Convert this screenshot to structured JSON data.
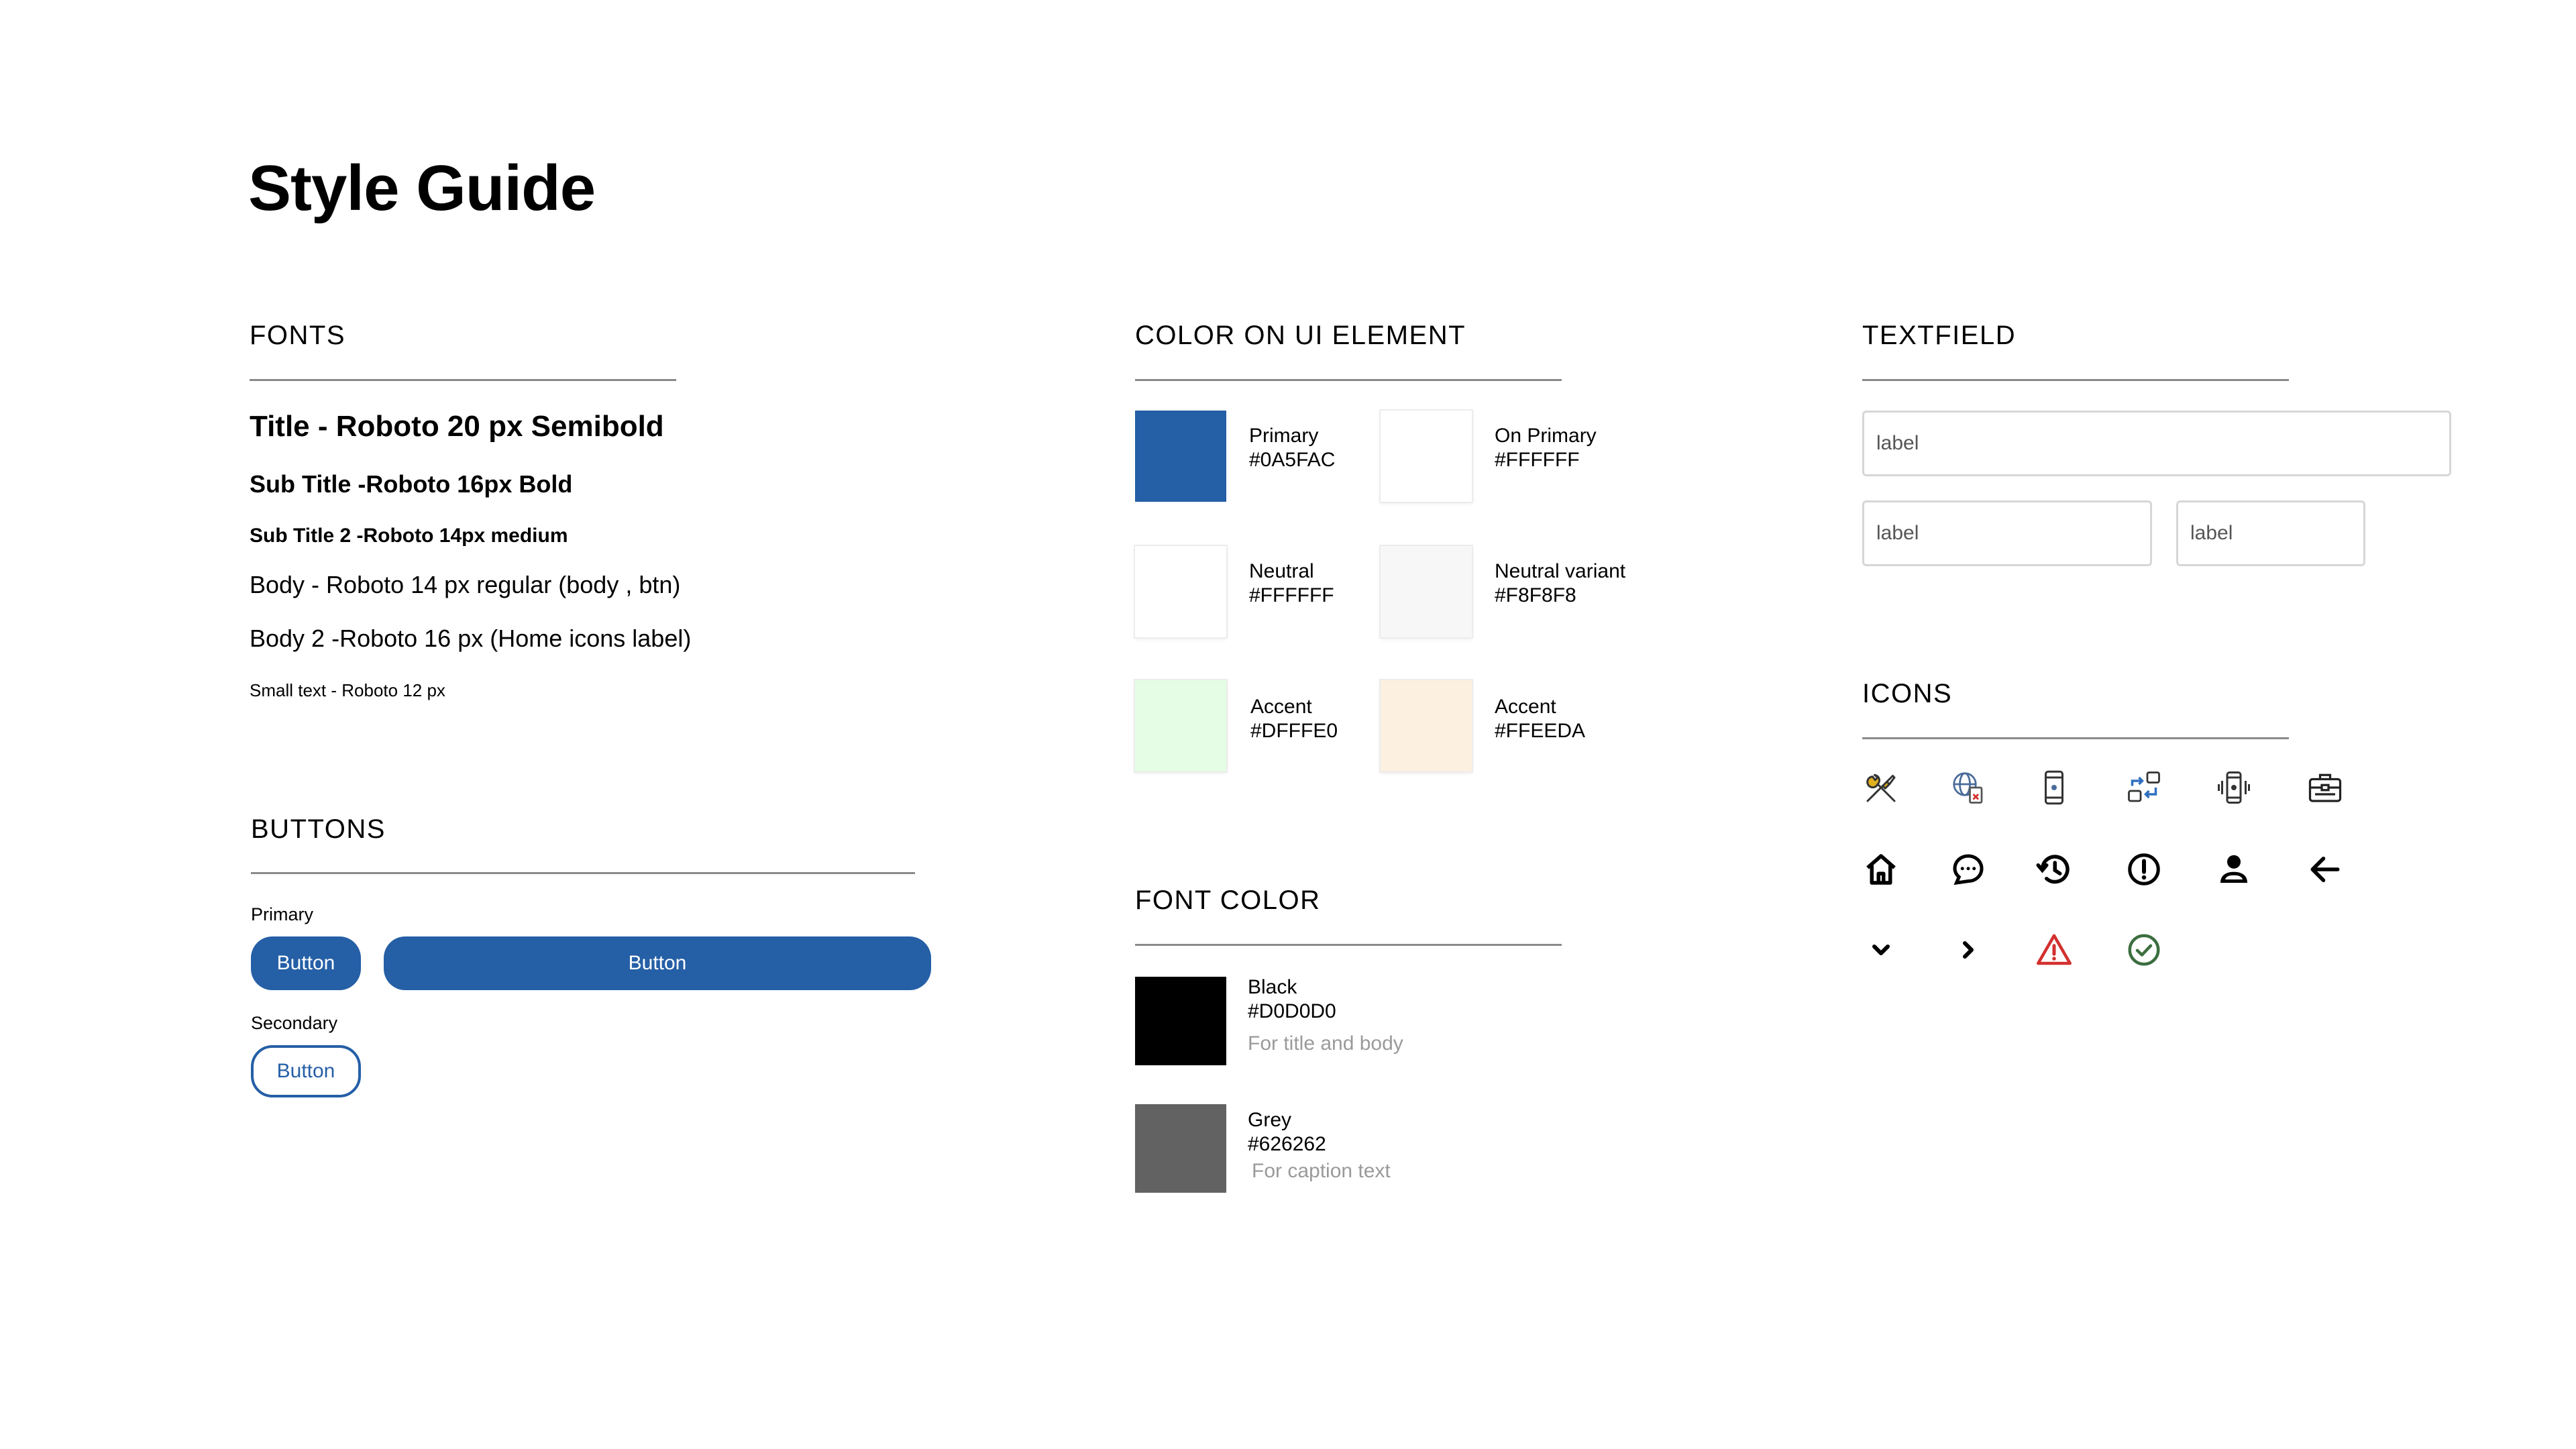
{
  "page": {
    "title": "Style Guide"
  },
  "fonts": {
    "heading": "FONTS",
    "samples": [
      "Title - Roboto 20 px Semibold",
      "Sub Title -Roboto 16px Bold",
      "Sub Title 2 -Roboto 14px medium",
      "Body - Roboto 14 px regular (body , btn)",
      "Body 2 -Roboto 16 px (Home icons label)",
      "Small text - Roboto 12 px"
    ]
  },
  "buttons": {
    "heading": "BUTTONS",
    "primary_label": "Primary",
    "secondary_label": "Secondary",
    "button_text": "Button"
  },
  "colors": {
    "heading": "COLOR ON UI ELEMENT",
    "swatches": [
      {
        "name": "Primary",
        "hex": "#0A5FAC",
        "fill": "#255fa6"
      },
      {
        "name": "On Primary",
        "hex": "#FFFFFF",
        "fill": "#ffffff"
      },
      {
        "name": "Neutral",
        "hex": "#FFFFFF",
        "fill": "#ffffff"
      },
      {
        "name": "Neutral variant",
        "hex": "#F8F8F8",
        "fill": "#f7f7f7"
      },
      {
        "name": "Accent",
        "hex": "#DFFFE0",
        "fill": "#e4fde4"
      },
      {
        "name": "Accent",
        "hex": "#FFEEDA",
        "fill": "#fcf0e0"
      }
    ]
  },
  "font_color": {
    "heading": "FONT COLOR",
    "items": [
      {
        "name": "Black",
        "hex": "#D0D0D0",
        "note": "For title and body",
        "fill": "#000000"
      },
      {
        "name": "Grey",
        "hex": "#626262",
        "note": "For caption text",
        "fill": "#626262"
      }
    ]
  },
  "textfield": {
    "heading": "TEXTFIELD",
    "fields": [
      {
        "placeholder": "label"
      },
      {
        "placeholder": "label"
      },
      {
        "placeholder": "label"
      }
    ]
  },
  "icons": {
    "heading": "ICONS",
    "items": [
      "tools-icon",
      "globe-document-icon",
      "mobile-device-icon",
      "device-swap-icon",
      "phone-vibrate-icon",
      "toolbox-icon",
      "home-icon",
      "chat-bubble-icon",
      "history-icon",
      "alert-circle-icon",
      "person-icon",
      "arrow-left-icon",
      "chevron-down-icon",
      "chevron-right-icon",
      "warning-triangle-icon",
      "check-circle-icon"
    ],
    "accent_colors": {
      "warning": "#d3302f",
      "success": "#3c6e3f"
    }
  }
}
